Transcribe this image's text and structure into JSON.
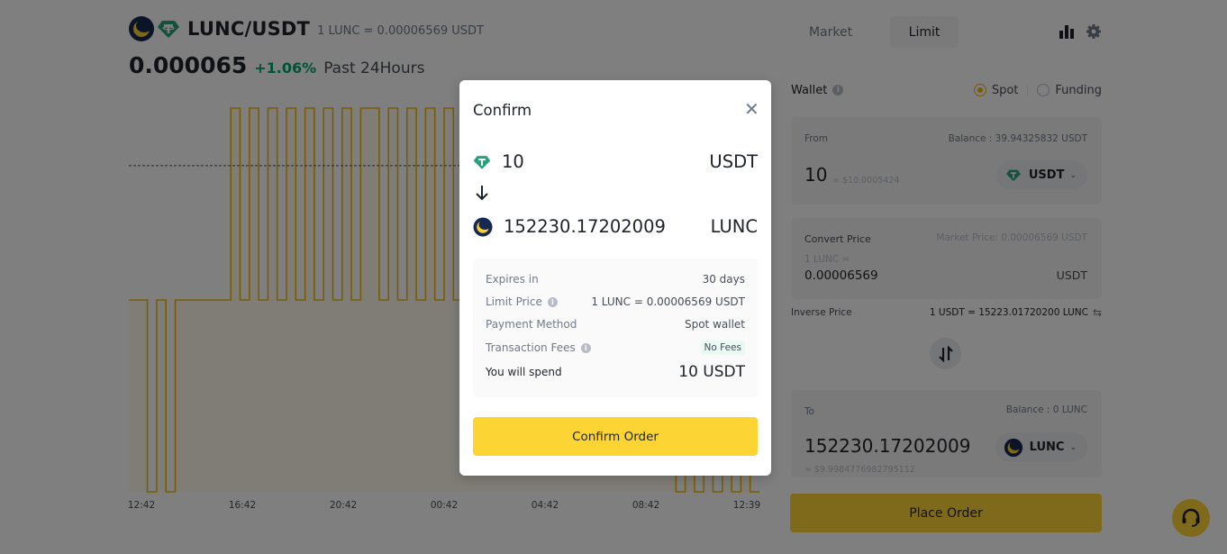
{
  "header": {
    "pair": "LUNC/USDT",
    "rate": "1 LUNC = 0.00006569 USDT",
    "price": "0.000065",
    "change": "+1.06%",
    "period": "Past 24Hours"
  },
  "chart_data": {
    "type": "line",
    "style": "step",
    "title": "",
    "xlabel": "",
    "ylabel": "",
    "x_tick_labels": [
      "12:42",
      "16:42",
      "20:42",
      "00:42",
      "04:42",
      "08:42",
      "12:39"
    ],
    "levels": {
      "high": 3,
      "mid": 2,
      "low": 1
    },
    "reference_line_level": 2.7,
    "values": [
      2,
      2,
      1,
      2,
      1,
      2,
      2,
      2,
      2,
      2,
      2,
      3,
      2,
      3,
      2,
      3,
      2,
      3,
      2,
      3,
      2,
      3,
      2,
      3,
      2,
      3,
      3,
      2,
      3,
      2,
      3,
      2,
      3,
      2,
      3,
      2,
      2,
      3,
      3,
      2,
      2,
      2,
      3,
      3,
      2,
      2,
      2,
      2,
      2,
      2,
      2,
      2,
      2,
      2,
      2,
      2,
      2,
      2,
      2,
      1,
      2,
      1,
      2,
      1,
      2,
      1,
      2,
      1
    ],
    "line_color": "#f0b90b",
    "grid": false,
    "legend": "none"
  },
  "tabs": {
    "market": "Market",
    "limit": "Limit"
  },
  "wallet": {
    "label": "Wallet",
    "options": [
      "Spot",
      "Funding"
    ],
    "selected": "Spot"
  },
  "from": {
    "label": "From",
    "balance": "Balance : 39.94325832 USDT",
    "amount": "10",
    "usd_value": "= $10.0005424",
    "coin": "USDT"
  },
  "convert_price": {
    "label": "Convert Price",
    "market_price": "Market Price: 0.00006569 USDT",
    "prefix": "1 LUNC =",
    "value": "0.00006569",
    "unit": "USDT"
  },
  "inverse": {
    "label": "Inverse Price",
    "value": "1 USDT = 15223.01720200 LUNC"
  },
  "to": {
    "label": "To",
    "balance": "Balance : 0 LUNC",
    "amount": "152230.17202009",
    "usd_value": "= $9.9984776982795112",
    "coin": "LUNC"
  },
  "place_order": "Place Order",
  "modal": {
    "title": "Confirm",
    "from_amount": "10",
    "from_unit": "USDT",
    "to_amount": "152230.17202009",
    "to_unit": "LUNC",
    "details": [
      {
        "label": "Expires in",
        "value": "30 days"
      },
      {
        "label": "Limit Price",
        "value": "1 LUNC = 0.00006569 USDT"
      },
      {
        "label": "Payment Method",
        "value": "Spot wallet"
      },
      {
        "label": "Transaction Fees",
        "value": "No Fees"
      }
    ],
    "spend_label": "You will spend",
    "spend_value": "10 USDT",
    "confirm_label": "Confirm Order"
  },
  "colors": {
    "accent": "#fcd535",
    "positive": "#03a66d",
    "usdt": "#26a17b",
    "lunc": "#172852"
  }
}
